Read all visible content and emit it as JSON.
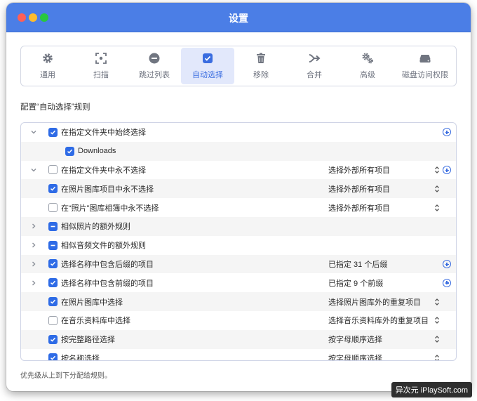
{
  "window": {
    "title": "设置"
  },
  "toolbar": {
    "items": [
      {
        "label": "通用",
        "icon": "gear-icon"
      },
      {
        "label": "扫描",
        "icon": "scan-icon"
      },
      {
        "label": "跳过列表",
        "icon": "minus-circle-icon"
      },
      {
        "label": "自动选择",
        "icon": "checkbox-icon",
        "active": true
      },
      {
        "label": "移除",
        "icon": "trash-icon"
      },
      {
        "label": "合并",
        "icon": "merge-icon"
      },
      {
        "label": "高级",
        "icon": "gears-icon"
      },
      {
        "label": "磁盘访问权限",
        "icon": "disk-icon"
      }
    ]
  },
  "section_title": "配置“自动选择”规则",
  "rules": [
    {
      "label": "在指定文件夹中始终选择",
      "expand": "down",
      "check": "checked",
      "value": "",
      "updown": false,
      "plus": true
    },
    {
      "label": "Downloads",
      "expand": "none",
      "check": "checked",
      "value": "",
      "updown": false,
      "plus": false,
      "sub": true
    },
    {
      "label": "在指定文件夹中永不选择",
      "expand": "down",
      "check": "empty",
      "value": "选择外部所有项目",
      "updown": true,
      "plus": true
    },
    {
      "label": "在照片图库项目中永不选择",
      "expand": "none",
      "check": "checked",
      "value": "选择外部所有项目",
      "updown": true,
      "plus": false
    },
    {
      "label": "在“照片”图库相簿中永不选择",
      "expand": "none",
      "check": "empty",
      "value": "选择外部所有项目",
      "updown": true,
      "plus": false
    },
    {
      "label": "相似照片的额外规则",
      "expand": "right",
      "check": "mixed",
      "value": "",
      "updown": false,
      "plus": false
    },
    {
      "label": "相似音频文件的额外规则",
      "expand": "right",
      "check": "mixed",
      "value": "",
      "updown": false,
      "plus": false
    },
    {
      "label": "选择名称中包含后缀的项目",
      "expand": "right",
      "check": "checked",
      "value": "已指定 31 个后缀",
      "updown": false,
      "plus": true
    },
    {
      "label": "选择名称中包含前缀的项目",
      "expand": "right",
      "check": "checked",
      "value": "已指定 9 个前缀",
      "updown": false,
      "plus": true
    },
    {
      "label": "在照片图库中选择",
      "expand": "none",
      "check": "checked",
      "value": "选择照片图库外的重复项目",
      "updown": true,
      "plus": false
    },
    {
      "label": "在音乐资料库中选择",
      "expand": "none",
      "check": "empty",
      "value": "选择音乐资料库外的重复项目",
      "updown": true,
      "plus": false
    },
    {
      "label": "按完整路径选择",
      "expand": "none",
      "check": "checked",
      "value": "按字母顺序选择",
      "updown": true,
      "plus": false
    },
    {
      "label": "按名称选择",
      "expand": "none",
      "check": "checked",
      "value": "按字母顺序选择",
      "updown": true,
      "plus": false
    }
  ],
  "footer_note": "优先级从上到下分配给规则。",
  "watermark": "异次元 iPlaySoft.com",
  "colors": {
    "accent": "#2e6be6",
    "titlebar": "#4b7ee6",
    "active_tab_bg": "#e2e8fb"
  }
}
